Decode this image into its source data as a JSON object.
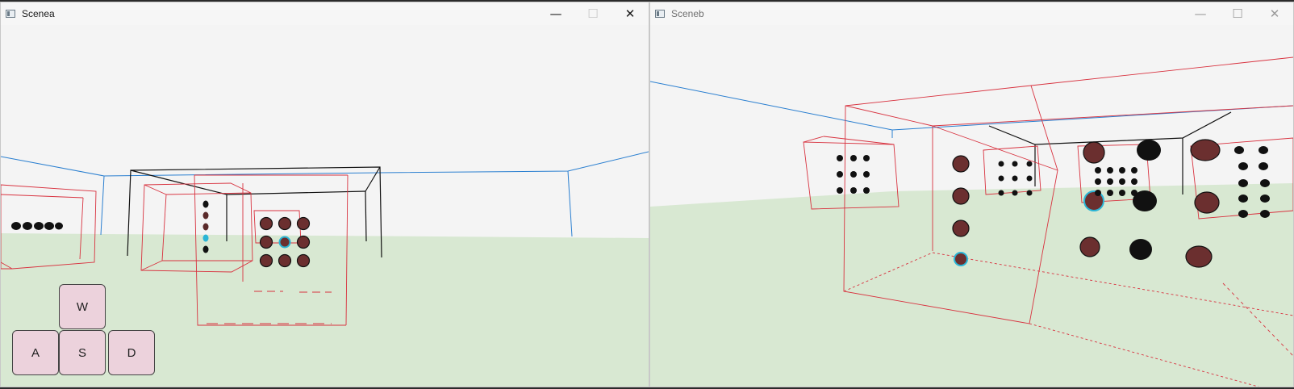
{
  "windows": [
    {
      "id": "scenea",
      "title": "Scenea",
      "controls": {
        "minimize": "—",
        "maximize": "☐",
        "close": "✕"
      }
    },
    {
      "id": "sceneb",
      "title": "Sceneb",
      "controls": {
        "minimize": "—",
        "maximize": "☐",
        "close": "✕"
      }
    }
  ],
  "keys": {
    "w": "W",
    "a": "A",
    "s": "S",
    "d": "D"
  },
  "colors": {
    "sky": "#f4f4f4",
    "ground": "#d8e8d2",
    "wall_line": "#2a7fd0",
    "box_line": "#d8323f",
    "frame_line": "#111111",
    "sphere": "#6b2f2f",
    "sphere_highlight": "#2ab5d6",
    "key_fill": "#ecd2dc"
  }
}
